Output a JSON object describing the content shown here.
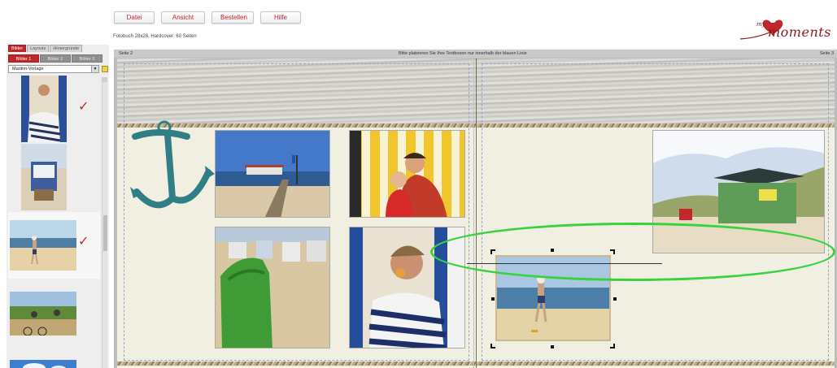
{
  "menu": {
    "datei": "Datei",
    "ansicht": "Ansicht",
    "bestellen": "Bestellen",
    "hilfe": "Hilfe"
  },
  "subtitle": "Fotobuch 28x28, Hardcover: 60 Seiten",
  "logo": {
    "prefix": "my",
    "text": "moments",
    "color": "#8b1a22"
  },
  "panel": {
    "tabs": [
      "Bilder",
      "Layouts",
      "Hintergründe"
    ],
    "subtabs": [
      "Bilder 1",
      "Bilder 2",
      "Bilder 3"
    ],
    "template_select": "Maritim-Vorlage",
    "thumbnails": [
      {
        "name": "boy-towel",
        "used": true
      },
      {
        "name": "beach-chair",
        "used": false
      },
      {
        "name": "child-on-beach",
        "used": true
      },
      {
        "name": "cyclists",
        "used": false
      },
      {
        "name": "sky",
        "used": false
      }
    ],
    "check_glyph": "✓"
  },
  "stage": {
    "page_left": "Seite 2",
    "hint": "Bitte platzieren Sie Ihre Textboxen nur innerhalb der blauen Linie",
    "page_right": "Seite 3"
  },
  "colors": {
    "accent": "#c0272d",
    "annotation": "#36d33c"
  }
}
